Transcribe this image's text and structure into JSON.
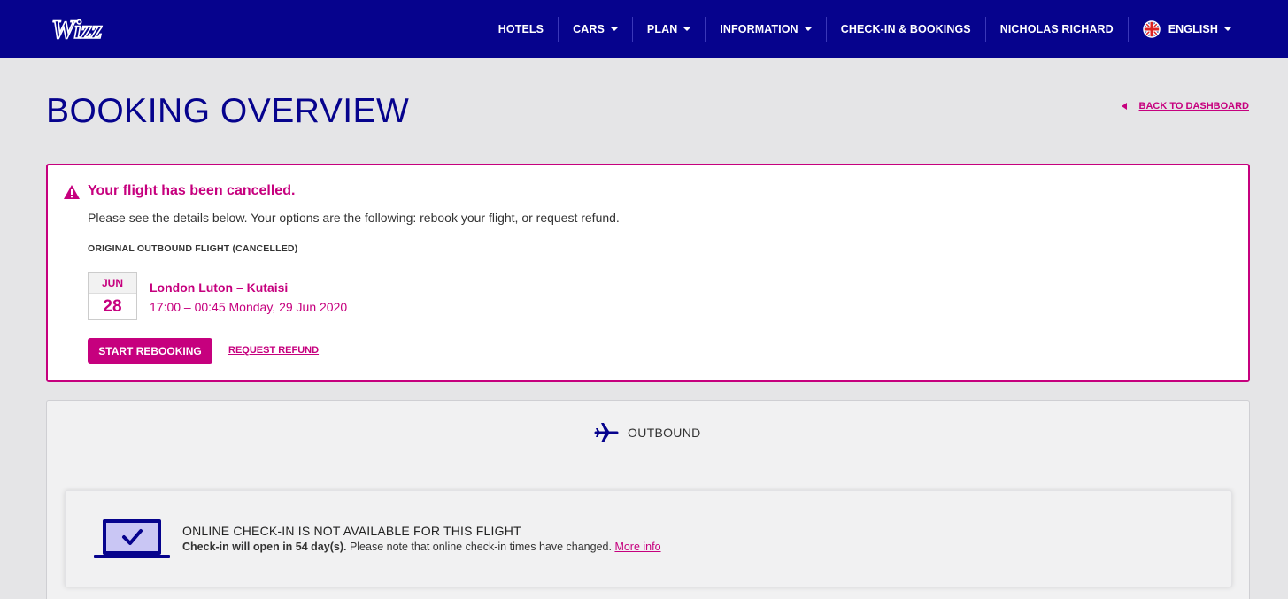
{
  "header": {
    "logo_text": "Wizz",
    "nav": {
      "hotels": "HOTELS",
      "cars": "CARS",
      "plan": "PLAN",
      "information": "INFORMATION",
      "checkin": "CHECK-IN & BOOKINGS",
      "user": "NICHOLAS RICHARD",
      "language": "ENGLISH"
    },
    "colors": {
      "bar": "#06038d"
    }
  },
  "page": {
    "title": "BOOKING OVERVIEW",
    "back_link": "BACK TO DASHBOARD"
  },
  "alert": {
    "title": "Your flight has been cancelled.",
    "message": "Please see the details below. Your options are the following: rebook your flight, or request refund.",
    "section_label": "ORIGINAL OUTBOUND FLIGHT (CANCELLED)",
    "date_month": "JUN",
    "date_day": "28",
    "route": "London Luton – Kutaisi",
    "times": "17:00 – 00:45 Monday, 29 Jun 2020",
    "rebook_button": "START REBOOKING",
    "refund_link": "REQUEST REFUND",
    "colors": {
      "accent": "#c6007e"
    }
  },
  "outbound": {
    "label": "OUTBOUND",
    "checkin_title": "ONLINE CHECK-IN IS NOT AVAILABLE FOR THIS FLIGHT",
    "checkin_bold": "Check-in will open in 54 day(s).",
    "checkin_note": " Please note that online check-in times have changed. ",
    "more_info": "More info"
  }
}
